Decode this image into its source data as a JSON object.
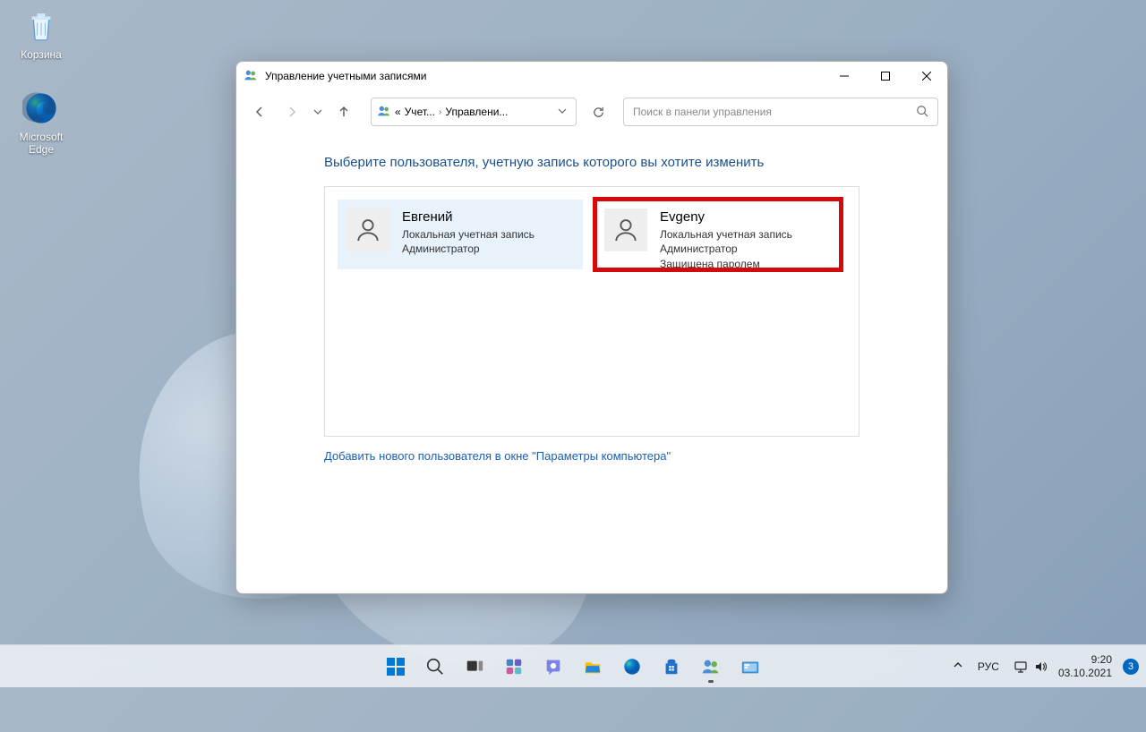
{
  "desktop": {
    "recycle_label": "Корзина",
    "edge_label": "Microsoft Edge"
  },
  "window": {
    "title": "Управление учетными записями",
    "breadcrumb": {
      "ellipsis": "«",
      "part1": "Учет...",
      "part2": "Управлени..."
    },
    "search": {
      "placeholder": "Поиск в панели управления"
    },
    "heading": "Выберите пользователя, учетную запись которого вы хотите изменить",
    "users": [
      {
        "name": "Евгений",
        "line1": "Локальная учетная запись",
        "line2": "Администратор",
        "line3": ""
      },
      {
        "name": "Evgeny",
        "line1": "Локальная учетная запись",
        "line2": "Администратор",
        "line3": "Защищена паролем"
      }
    ],
    "add_link": "Добавить нового пользователя в окне \"Параметры компьютера\""
  },
  "taskbar": {
    "lang": "РУС",
    "time": "9:20",
    "date": "03.10.2021",
    "notif_count": "3"
  }
}
